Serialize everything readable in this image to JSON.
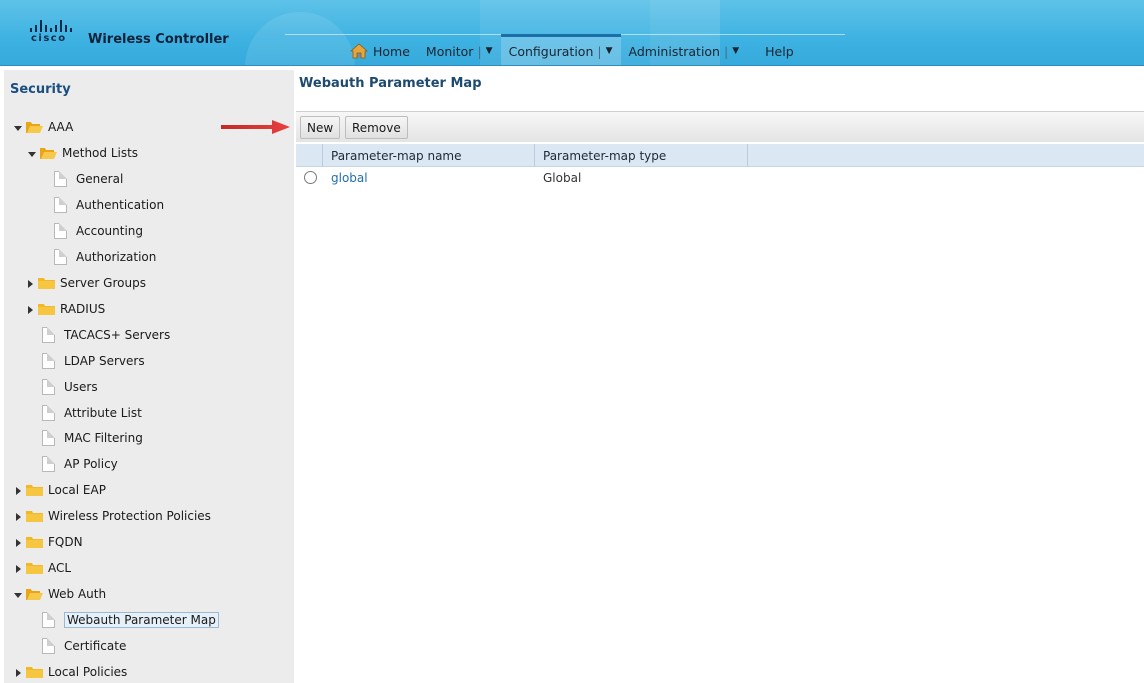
{
  "header": {
    "brand": "cisco",
    "app_title": "Wireless Controller",
    "nav": [
      {
        "label": "Home",
        "icon": "home-icon"
      },
      {
        "label": "Monitor",
        "has_dropdown": true
      },
      {
        "label": "Configuration",
        "has_dropdown": true,
        "active": true
      },
      {
        "label": "Administration",
        "has_dropdown": true
      },
      {
        "label": "Help"
      }
    ],
    "caret": "▼",
    "separator": "|"
  },
  "sidebar": {
    "title": "Security",
    "items": [
      {
        "label": "AAA",
        "type": "folder",
        "expanded": true
      },
      {
        "label": "Method Lists",
        "type": "folder",
        "expanded": true
      },
      {
        "label": "General",
        "type": "doc"
      },
      {
        "label": "Authentication",
        "type": "doc"
      },
      {
        "label": "Accounting",
        "type": "doc"
      },
      {
        "label": "Authorization",
        "type": "doc"
      },
      {
        "label": "Server Groups",
        "type": "folder",
        "expanded": false
      },
      {
        "label": "RADIUS",
        "type": "folder",
        "expanded": false
      },
      {
        "label": "TACACS+ Servers",
        "type": "doc"
      },
      {
        "label": "LDAP Servers",
        "type": "doc"
      },
      {
        "label": "Users",
        "type": "doc"
      },
      {
        "label": "Attribute List",
        "type": "doc"
      },
      {
        "label": "MAC Filtering",
        "type": "doc"
      },
      {
        "label": "AP Policy",
        "type": "doc"
      },
      {
        "label": "Local EAP",
        "type": "folder",
        "expanded": false
      },
      {
        "label": "Wireless Protection Policies",
        "type": "folder",
        "expanded": false
      },
      {
        "label": "FQDN",
        "type": "folder",
        "expanded": false
      },
      {
        "label": "ACL",
        "type": "folder",
        "expanded": false
      },
      {
        "label": "Web Auth",
        "type": "folder",
        "expanded": true
      },
      {
        "label": "Webauth Parameter Map",
        "type": "doc",
        "selected": true
      },
      {
        "label": "Certificate",
        "type": "doc"
      },
      {
        "label": "Local Policies",
        "type": "folder",
        "expanded": false
      }
    ]
  },
  "main": {
    "title": "Webauth Parameter Map",
    "toolbar": {
      "new_label": "New",
      "remove_label": "Remove"
    },
    "columns": [
      "Parameter-map name",
      "Parameter-map type"
    ],
    "rows": [
      {
        "name": "global",
        "type": "Global",
        "selected": false
      }
    ]
  },
  "annotation": {
    "icon": "red-arrow-icon",
    "color": "#e03a3a"
  },
  "colors": {
    "header": "#3eb2e2",
    "link": "#1f6fb0",
    "title": "#1e4a70",
    "folder": "#f2b826"
  }
}
